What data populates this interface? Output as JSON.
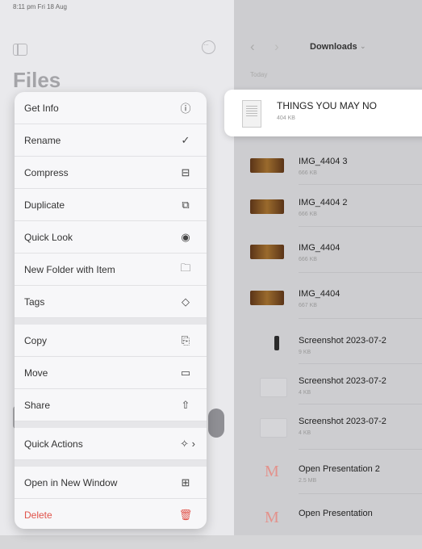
{
  "status_bar": {
    "text": "8:11 pm  Fri 18 Aug"
  },
  "sidebar": {
    "title": "Files"
  },
  "context_menu": {
    "items": [
      {
        "label": "Get Info",
        "icon": "ⓘ",
        "icon_name": "info-icon"
      },
      {
        "label": "Rename",
        "icon": "✓",
        "icon_name": "pencil-icon"
      },
      {
        "label": "Compress",
        "icon": "⊟",
        "icon_name": "archive-box-icon"
      },
      {
        "label": "Duplicate",
        "icon": "⧉",
        "icon_name": "duplicate-icon"
      },
      {
        "label": "Quick Look",
        "icon": "◉",
        "icon_name": "eye-icon"
      },
      {
        "label": "New Folder with Item",
        "icon": "🗀",
        "icon_name": "folder-plus-icon"
      },
      {
        "label": "Tags",
        "icon": "◇",
        "icon_name": "tag-icon"
      },
      {
        "label": "Copy",
        "icon": "⎘",
        "icon_name": "copy-icon"
      },
      {
        "label": "Move",
        "icon": "▭",
        "icon_name": "folder-icon"
      },
      {
        "label": "Share",
        "icon": "⇧",
        "icon_name": "share-icon"
      },
      {
        "label": "Quick Actions",
        "icon": "✧ ›",
        "icon_name": "sparkles-icon"
      },
      {
        "label": "Open in New Window",
        "icon": "⊞",
        "icon_name": "new-window-icon"
      },
      {
        "label": "Delete",
        "icon": "🗑",
        "icon_name": "trash-icon"
      }
    ]
  },
  "nav": {
    "back_icon": "‹",
    "forward_icon": "›",
    "title": "Downloads",
    "chevron": "⌄",
    "subheading": "Today"
  },
  "selected_file": {
    "name": "THINGS YOU MAY NO",
    "meta": "404 KB"
  },
  "files": [
    {
      "name": "IMG_4404 3",
      "meta": "666 KB",
      "thumb": "photo"
    },
    {
      "name": "IMG_4404 2",
      "meta": "666 KB",
      "thumb": "photo"
    },
    {
      "name": "IMG_4404",
      "meta": "666 KB",
      "thumb": "photo"
    },
    {
      "name": "IMG_4404",
      "meta": "667 KB",
      "thumb": "photo"
    },
    {
      "name": "Screenshot 2023-07-2",
      "meta": "9 KB",
      "thumb": "tall"
    },
    {
      "name": "Screenshot 2023-07-2",
      "meta": "4 KB",
      "thumb": "blank"
    },
    {
      "name": "Screenshot 2023-07-2",
      "meta": "4 KB",
      "thumb": "blank"
    },
    {
      "name": "Open Presentation 2",
      "meta": "2.5 MB",
      "thumb": "M"
    },
    {
      "name": "Open Presentation",
      "meta": "",
      "thumb": "M"
    }
  ]
}
